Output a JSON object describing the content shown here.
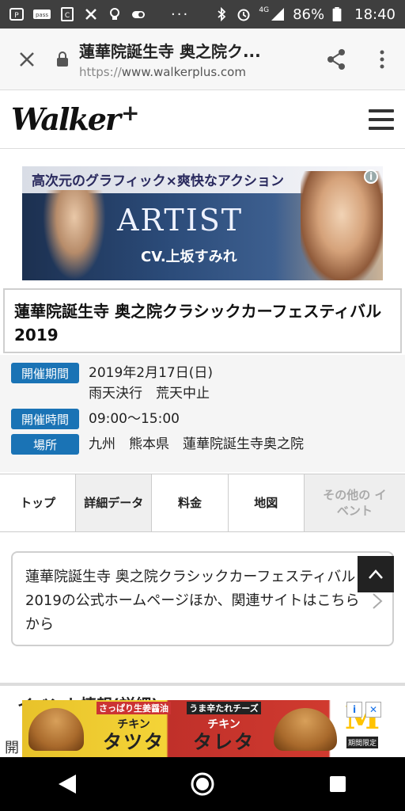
{
  "status_bar": {
    "battery": "86%",
    "time": "18:40",
    "network": "4G",
    "dots": "···"
  },
  "browser": {
    "page_title": "蓮華院誕生寺 奥之院ク...",
    "url_scheme": "https://",
    "url_host": "www.walkerplus.com"
  },
  "site": {
    "logo_text": "Walker",
    "logo_plus": "+"
  },
  "ad_top": {
    "catch": "高次元のグラフィック×爽快なアクション",
    "headline": "ARTIST",
    "sub": "CV.上坂すみれ",
    "info": "i"
  },
  "event": {
    "title": "蓮華院誕生寺 奥之院クラシックカーフェスティバル2019",
    "period_label": "開催期間",
    "period_value": "2019年2月17日(日)",
    "period_note": "雨天決行　荒天中止",
    "time_label": "開催時間",
    "time_value": "09:00〜15:00",
    "place_label": "場所",
    "place_value": "九州　熊本県　蓮華院誕生寺奥之院"
  },
  "tabs": [
    {
      "label": "トップ"
    },
    {
      "label": "詳細データ"
    },
    {
      "label": "料金"
    },
    {
      "label": "地図"
    },
    {
      "label": "その他の イベント"
    }
  ],
  "link_box": {
    "text": "蓮華院誕生寺 奥之院クラシックカーフェスティバル2019の公式ホームページほか、関連サイトはこちらから"
  },
  "background": {
    "heading": "イベント情報(詳細)",
    "fragment": "開"
  },
  "ad_bottom": {
    "left_tag": "さっぱり生姜醤油",
    "left_item": "チキン",
    "left_name": "タツタ",
    "right_tag": "うま辛たれチーズ",
    "right_item": "チキン",
    "right_name": "タレタ",
    "logo": "M",
    "logo_tag": "期間限定",
    "ad_choice": "i",
    "ad_close": "✕"
  },
  "colors": {
    "badge": "#1a73b5",
    "status_bar": "#3f3f3f"
  }
}
